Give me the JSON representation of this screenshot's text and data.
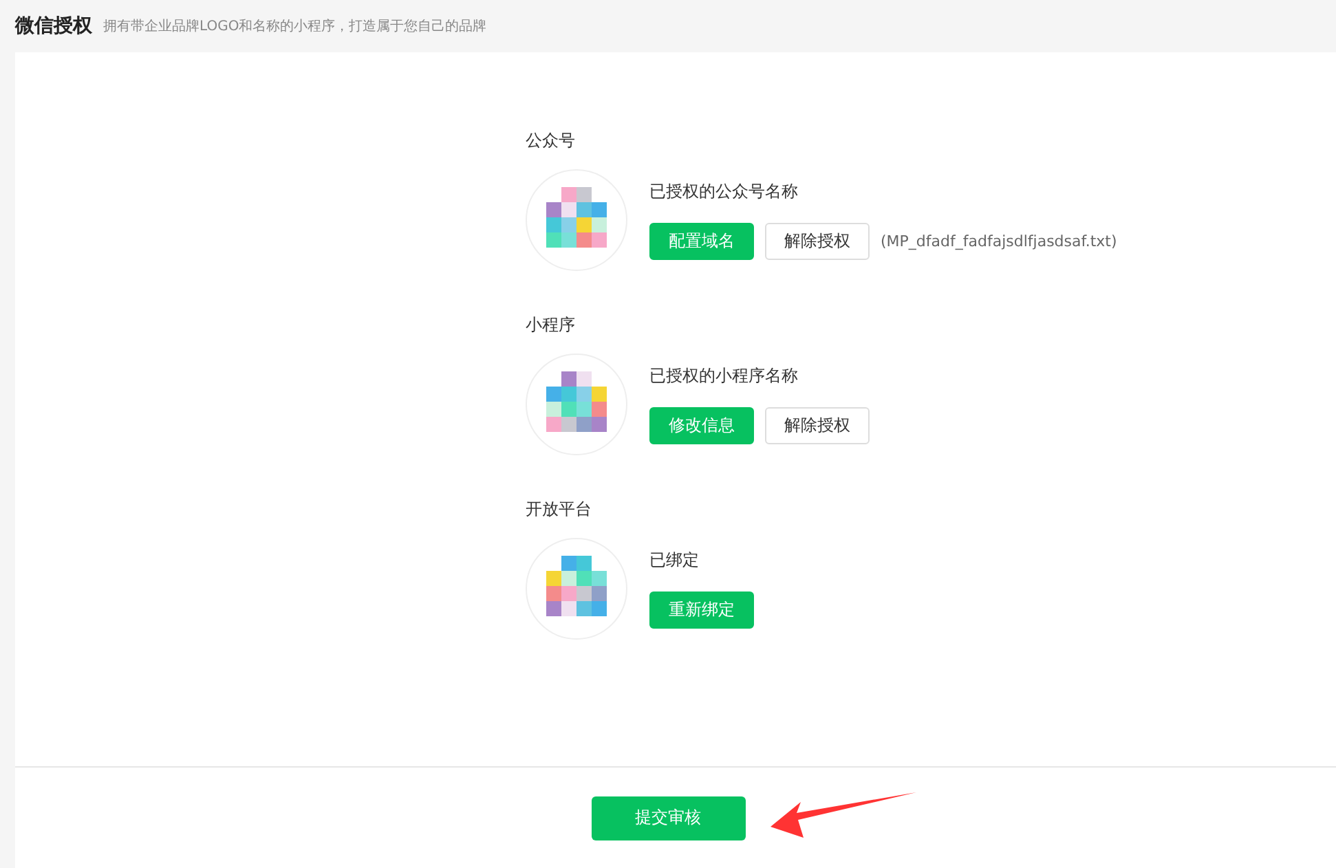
{
  "header": {
    "title": "微信授权",
    "subtitle": "拥有带企业品牌LOGO和名称的小程序，打造属于您自己的品牌"
  },
  "sections": [
    {
      "title": "公众号",
      "name": "已授权的公众号名称",
      "buttons": [
        {
          "label": "配置域名",
          "kind": "primary"
        },
        {
          "label": "解除授权",
          "kind": "default"
        }
      ],
      "note": "(MP_dfadf_fadfajsdlfjasdsaf.txt)"
    },
    {
      "title": "小程序",
      "name": "已授权的小程序名称",
      "buttons": [
        {
          "label": "修改信息",
          "kind": "primary"
        },
        {
          "label": "解除授权",
          "kind": "default"
        }
      ]
    },
    {
      "title": "开放平台",
      "name": "已绑定",
      "buttons": [
        {
          "label": "重新绑定",
          "kind": "primary"
        }
      ]
    }
  ],
  "submit": {
    "label": "提交审核"
  }
}
